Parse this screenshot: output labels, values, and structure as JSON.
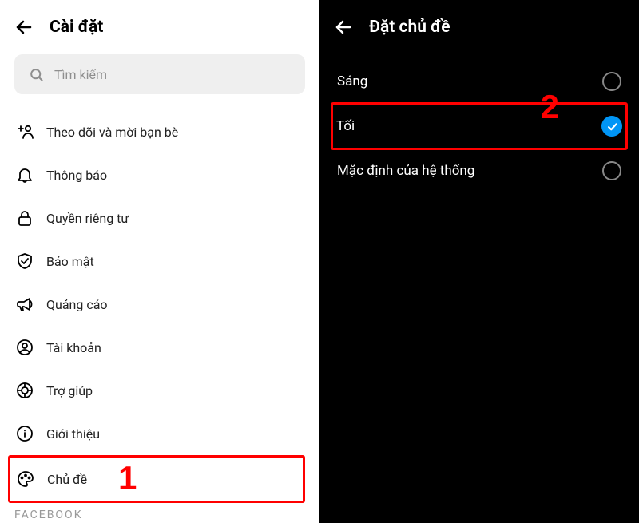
{
  "left": {
    "title": "Cài đặt",
    "search_placeholder": "Tìm kiếm",
    "menu": [
      {
        "label": "Theo dõi và mời bạn bè",
        "icon": "user-plus-icon"
      },
      {
        "label": "Thông báo",
        "icon": "bell-icon"
      },
      {
        "label": "Quyền riêng tư",
        "icon": "lock-icon"
      },
      {
        "label": "Bảo mật",
        "icon": "shield-icon"
      },
      {
        "label": "Quảng cáo",
        "icon": "megaphone-icon"
      },
      {
        "label": "Tài khoản",
        "icon": "account-icon"
      },
      {
        "label": "Trợ giúp",
        "icon": "help-icon"
      },
      {
        "label": "Giới thiệu",
        "icon": "info-icon"
      },
      {
        "label": "Chủ đề",
        "icon": "palette-icon"
      }
    ],
    "footer": "FACEBOOK",
    "annotation": "1"
  },
  "right": {
    "title": "Đặt chủ đề",
    "options": [
      {
        "label": "Sáng",
        "selected": false
      },
      {
        "label": "Tối",
        "selected": true
      },
      {
        "label": "Mặc định của hệ thống",
        "selected": false
      }
    ],
    "annotation": "2"
  },
  "colors": {
    "highlight": "#ff0000",
    "accent": "#0095f6"
  }
}
